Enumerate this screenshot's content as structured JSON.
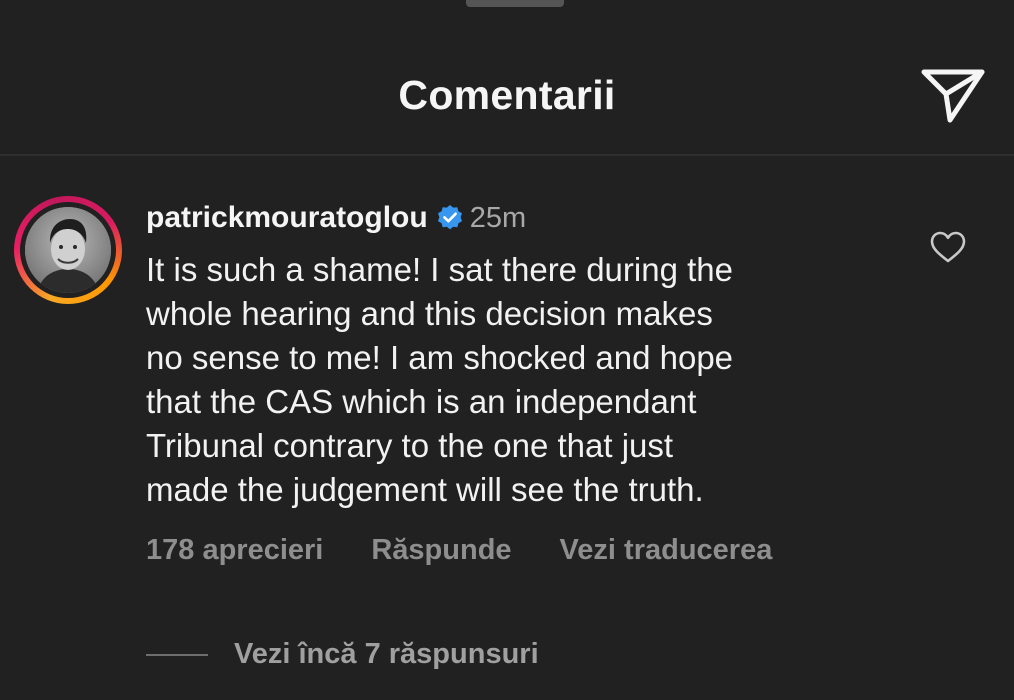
{
  "header": {
    "title": "Comentarii",
    "share_icon": "paper-plane-icon"
  },
  "comment": {
    "username": "patrickmouratoglou",
    "verified_icon": "verified-badge-icon",
    "verified_color": "#3797f0",
    "time": "25m",
    "text_lines": [
      "It is such a shame! I sat there during the",
      "whole hearing and this decision makes",
      "no sense to me! I am shocked and hope",
      "that the CAS which is an independant",
      "Tribunal contrary to the one that just",
      "made the judgement will see the truth."
    ],
    "like_icon": "heart-outline-icon",
    "actions": {
      "likes": "178 aprecieri",
      "reply": "Răspunde",
      "translate": "Vezi traducerea"
    },
    "view_replies": "Vezi încă 7 răspunsuri"
  },
  "colors": {
    "background": "#212121",
    "story_ring_start": "#f9a825",
    "story_ring_end": "#e91e63"
  }
}
